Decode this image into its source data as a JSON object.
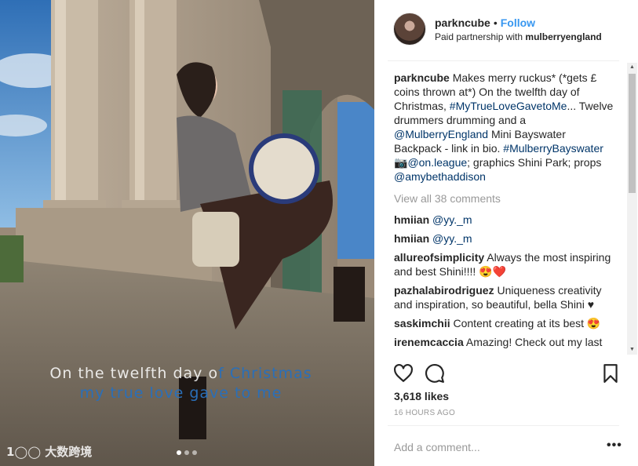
{
  "media": {
    "caption_line1_a": "On the twelfth day o",
    "caption_line1_b": "f Christmas",
    "caption_line2": "my true love gave to me",
    "watermark": "大数跨境",
    "carousel": {
      "count": 3,
      "active_index": 0
    }
  },
  "header": {
    "username": "parkncube",
    "bullet": "•",
    "follow_label": "Follow",
    "partnership_prefix": "Paid partnership with",
    "partner": "mulberryengland"
  },
  "caption": {
    "username": "parkncube",
    "text_1": "Makes merry ruckus* (*gets £ coins thrown at*) On the twelfth day of Christmas,",
    "hashtag_1": "#MyTrueLoveGavetoMe",
    "text_2": "... Twelve drummers drumming and a",
    "mention_1": "@MulberryEngland",
    "text_3": "Mini Bayswater Backpack - link in bio.",
    "hashtag_2": "#MulberryBayswater",
    "camera_icon": "📷",
    "mention_2": "@on.league",
    "text_4": "; graphics Shini Park; props",
    "mention_3": "@amybethaddison"
  },
  "view_all_comments": "View all 38 comments",
  "comments": [
    {
      "user": "hmiian",
      "text": "",
      "mention": "@yy._m"
    },
    {
      "user": "hmiian",
      "text": "",
      "mention": "@yy._m"
    },
    {
      "user": "allureofsimplicity",
      "text": "Always the most inspiring and best Shini!!!! 😍❤️",
      "mention": ""
    },
    {
      "user": "pazhalabirodriguez",
      "text": "Uniqueness creativity and inspiration, so beautiful, bella Shini ♥",
      "mention": ""
    },
    {
      "user": "saskimchii",
      "text": "Content creating at its best 😍",
      "mention": ""
    },
    {
      "user": "irenemcaccia",
      "text": "Amazing! Check out my last",
      "mention": ""
    }
  ],
  "actions": {
    "like_icon": "heart-icon",
    "comment_icon": "comment-icon",
    "save_icon": "bookmark-icon"
  },
  "likes": "3,618 likes",
  "time_ago": "16 HOURS AGO",
  "add_comment_placeholder": "Add a comment...",
  "more_options": "•••",
  "colors": {
    "follow_blue": "#3897f0",
    "link_blue": "#003569",
    "muted_gray": "#999999",
    "overlay_blue": "#2a6fb8"
  }
}
